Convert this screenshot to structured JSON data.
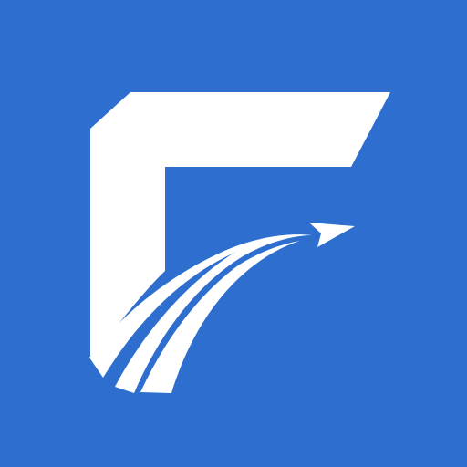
{
  "app_icon": {
    "icon": "f-paper-plane-logo",
    "background_color": "#2d6ecf",
    "foreground_color": "#ffffff"
  }
}
